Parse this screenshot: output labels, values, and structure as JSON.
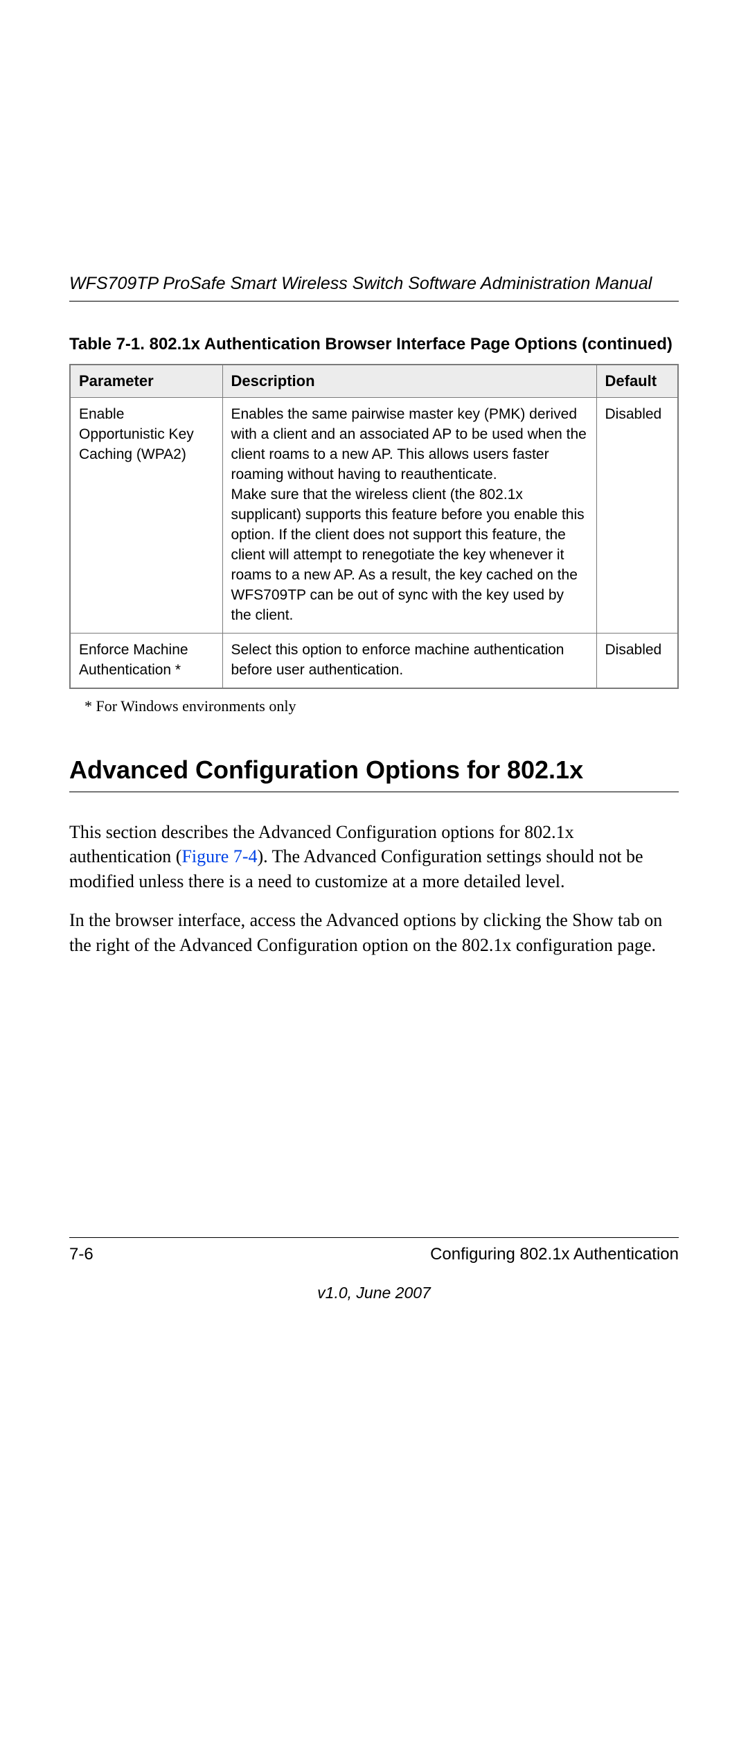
{
  "header": {
    "running_title": "WFS709TP ProSafe Smart Wireless Switch Software Administration Manual"
  },
  "table": {
    "caption": "Table 7-1.  802.1x Authentication Browser Interface Page Options (continued)",
    "headers": {
      "parameter": "Parameter",
      "description": "Description",
      "default": "Default"
    },
    "rows": [
      {
        "parameter": "Enable Opportunistic Key Caching (WPA2)",
        "description": "Enables the same pairwise master key (PMK) derived with a client and an associated AP to be used when the client roams to a new AP. This allows users faster roaming without having to reauthenticate.\nMake sure that the wireless client (the 802.1x supplicant) supports this feature before you enable this option. If the client does not support this feature, the client will attempt to renegotiate the key whenever it roams to a new AP. As a result, the key cached on the WFS709TP can be out of sync with the key used by the client.",
        "default": "Disabled"
      },
      {
        "parameter": "Enforce Machine Authentication *",
        "description": "Select this option to enforce machine authentication before user authentication.",
        "default": "Disabled"
      }
    ],
    "footnote": "* For Windows environments only"
  },
  "section": {
    "heading": "Advanced Configuration Options for 802.1x",
    "para1_pre": "This section describes the Advanced Configuration options for 802.1x authentication (",
    "para1_link": "Figure 7-4",
    "para1_post": "). The Advanced Configuration settings should not be modified unless there is a need to customize at a more detailed level.",
    "para2": "In the browser interface, access the Advanced options by clicking the Show tab on the right of the Advanced Configuration option on the 802.1x configuration page."
  },
  "footer": {
    "page_number": "7-6",
    "chapter_title": "Configuring 802.1x Authentication",
    "version": "v1.0, June 2007"
  }
}
